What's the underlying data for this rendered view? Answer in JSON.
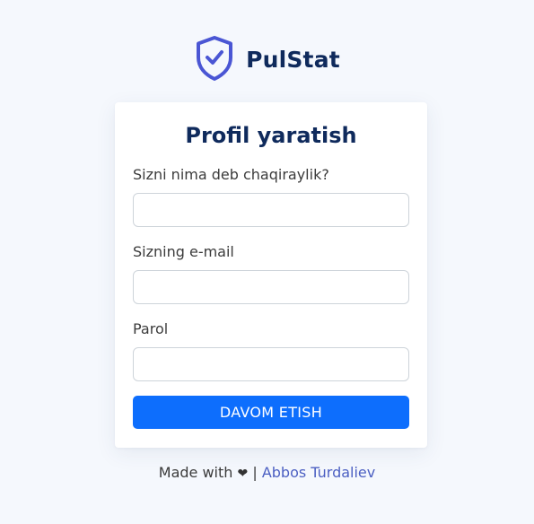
{
  "brand": {
    "name": "PulStat",
    "icon": "shield-check-icon",
    "color": "#4a56d4"
  },
  "form": {
    "title": "Profil yaratish",
    "fields": [
      {
        "label": "Sizni nima deb chaqiraylik?",
        "value": "",
        "placeholder": ""
      },
      {
        "label": "Sizning e-mail",
        "value": "",
        "placeholder": ""
      },
      {
        "label": "Parol",
        "value": "",
        "placeholder": ""
      }
    ],
    "submit_label": "DAVOM ETISH"
  },
  "footer": {
    "made_with": "Made with",
    "heart": "❤",
    "separator": "|",
    "author": "Abbos Turdaliev"
  },
  "colors": {
    "background": "#f5f8fd",
    "card": "#ffffff",
    "primary_button": "#0d6efd",
    "title_text": "#0f2a5c",
    "link": "#4b5fc2"
  }
}
